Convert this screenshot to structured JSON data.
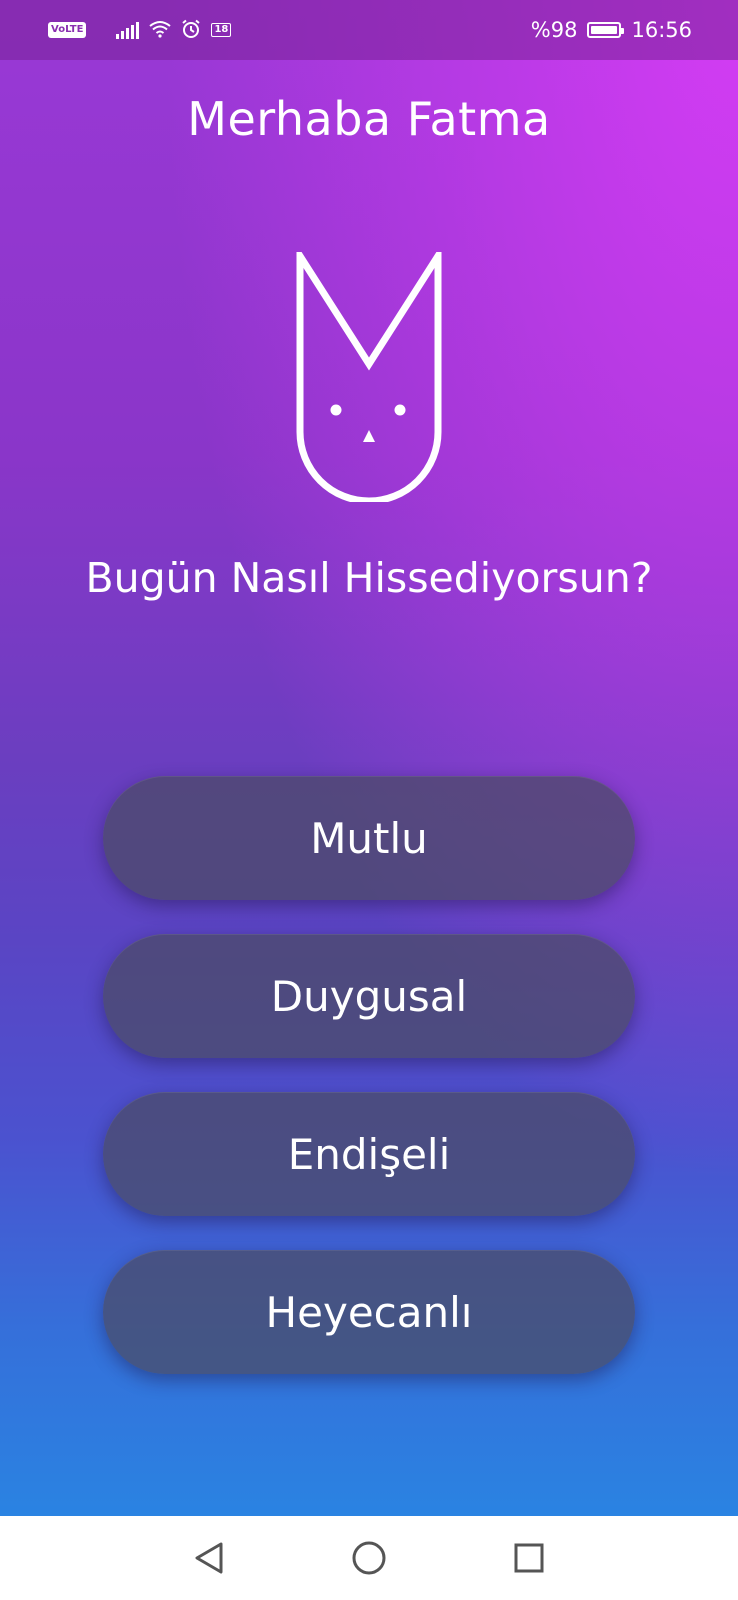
{
  "status_bar": {
    "network_badge": "VoLTE",
    "alarm_icon": "alarm-icon",
    "badge_number": "18",
    "battery_text": "%98",
    "battery_level": 0.98,
    "time": "16:56"
  },
  "greeting": "Merhaba Fatma",
  "question": "Bugün Nasıl Hissediyorsun?",
  "moods": [
    {
      "label": "Mutlu"
    },
    {
      "label": "Duygusal"
    },
    {
      "label": "Endişeli"
    },
    {
      "label": "Heyecanlı"
    }
  ],
  "nav": {
    "back_icon": "back-triangle-icon",
    "home_icon": "home-circle-icon",
    "recents_icon": "recents-square-icon"
  },
  "colors": {
    "accent_top": "#d63cf5",
    "gradient_mid": "#6b3ec0",
    "gradient_bottom": "#2a83e2",
    "button_bg": "#4b4b64"
  }
}
